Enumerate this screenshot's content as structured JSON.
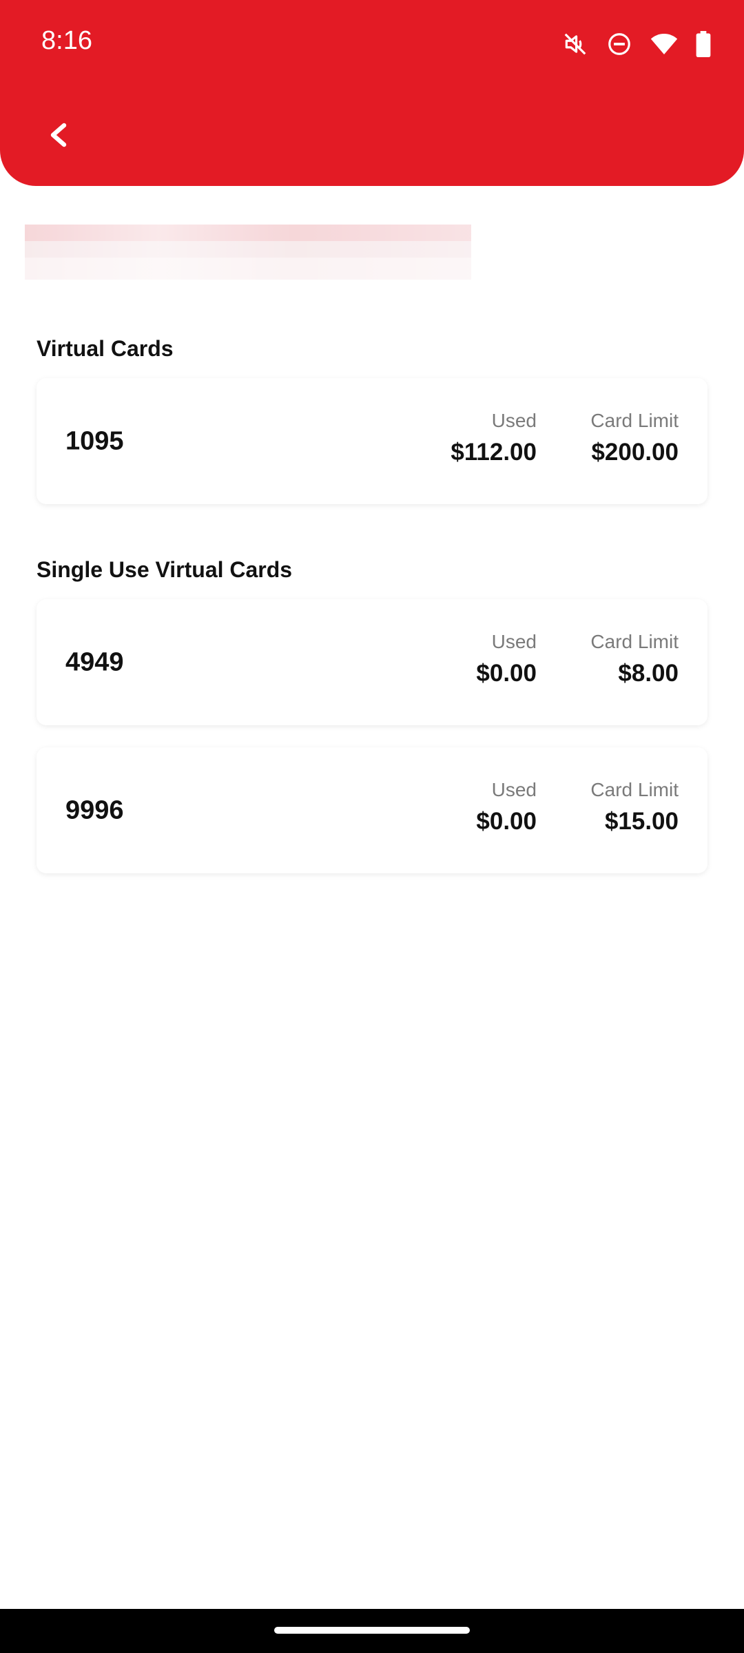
{
  "status_bar": {
    "time": "8:16",
    "icons": [
      "mute-icon",
      "do-not-disturb-icon",
      "wifi-icon",
      "battery-icon"
    ]
  },
  "header": {
    "back_icon": "chevron-left-icon",
    "color": "#e31b25"
  },
  "sections": [
    {
      "title": "Virtual Cards",
      "cards": [
        {
          "number": "1095",
          "used_label": "Used",
          "used": "$112.00",
          "limit_label": "Card Limit",
          "limit": "$200.00"
        }
      ]
    },
    {
      "title": "Single Use Virtual Cards",
      "cards": [
        {
          "number": "4949",
          "used_label": "Used",
          "used": "$0.00",
          "limit_label": "Card Limit",
          "limit": "$8.00"
        },
        {
          "number": "9996",
          "used_label": "Used",
          "used": "$0.00",
          "limit_label": "Card Limit",
          "limit": "$15.00"
        }
      ]
    }
  ]
}
